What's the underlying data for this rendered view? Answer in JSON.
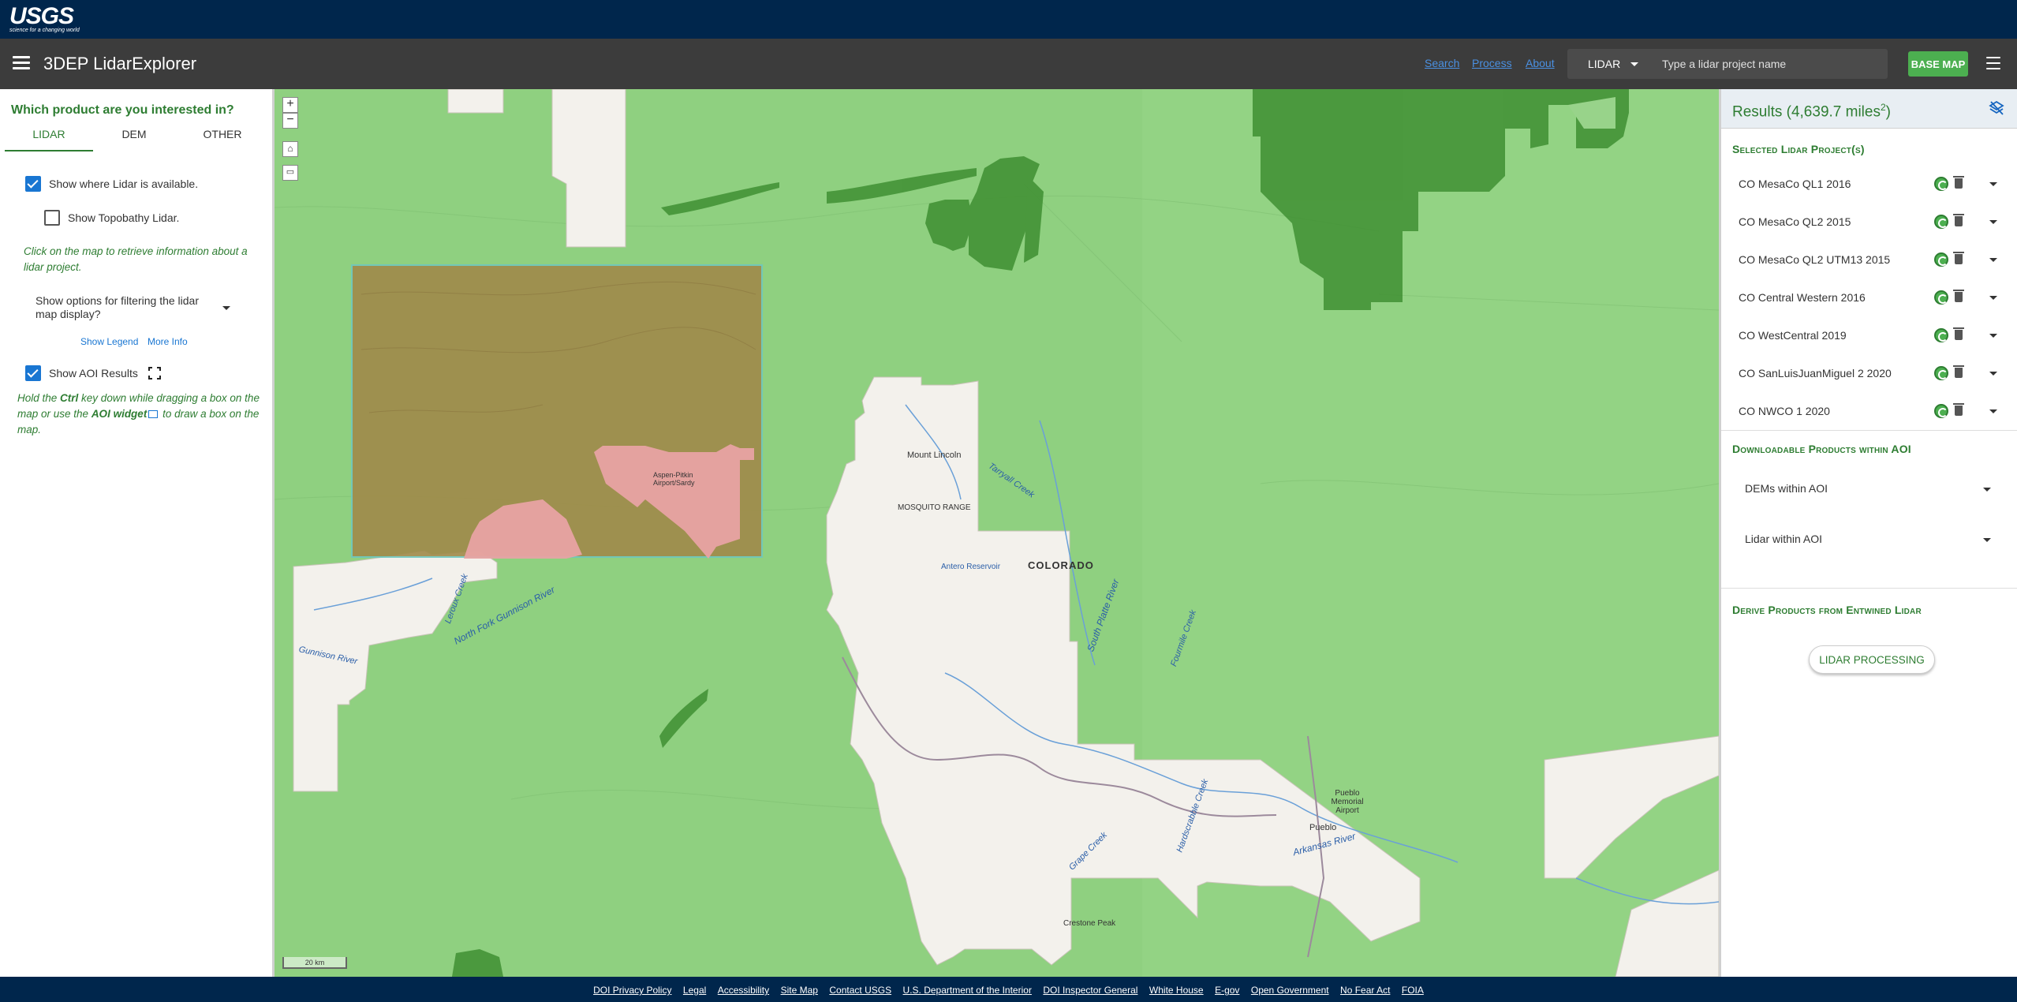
{
  "banner": {
    "logo_text": "USGS",
    "logo_tagline": "science for a changing world"
  },
  "header": {
    "app_title": "3DEP LidarExplorer",
    "links": [
      "Search",
      "Process",
      "About"
    ],
    "data_type": "LIDAR",
    "search_placeholder": "Type a lidar project name",
    "basemap_label": "BASE MAP",
    "menu_icon": "hamburger-icon"
  },
  "left_panel": {
    "question": "Which product are you interested in?",
    "tabs": [
      {
        "label": "LIDAR",
        "active": true
      },
      {
        "label": "DEM",
        "active": false
      },
      {
        "label": "OTHER",
        "active": false
      }
    ],
    "show_lidar_label": "Show where Lidar is available.",
    "show_lidar_checked": true,
    "show_topobathy_label": "Show Topobathy Lidar.",
    "show_topobathy_checked": false,
    "click_note": "Click on the map to retrieve information about a lidar project.",
    "filter_options_label": "Show options for filtering the lidar map display?",
    "show_legend_label": "Show Legend",
    "more_info_label": "More Info",
    "show_aoi_label": "Show AOI Results",
    "show_aoi_checked": true,
    "aoi_note_part1": "Hold the ",
    "aoi_note_ctrl": "Ctrl",
    "aoi_note_part2": " key down while dragging a box on the map or use the ",
    "aoi_note_widget": "AOI widget",
    "aoi_note_part3": " to draw a box on the map."
  },
  "map": {
    "zoom_in": "+",
    "zoom_out": "−",
    "scale_label": "20 km",
    "labels": [
      "COLORADO",
      "Arkansas River",
      "South Platte River",
      "Fourmile Creek",
      "Grape Creek",
      "Hardscrabble Creek",
      "North Fork Gunnison River",
      "Gunnison River",
      "Mount Lincoln",
      "Antero Reservoir",
      "MOSQUITO RANGE",
      "Tarryall Creek",
      "Pueblo",
      "Pueblo Memorial Airport",
      "Aspen-Pitkin Airport/Sardy",
      "Crestone Peak",
      "Leroux Creek"
    ]
  },
  "right_panel": {
    "results_prefix": "Results (4,639.7 miles",
    "results_sup": "2",
    "results_suffix": ")",
    "selected_title": "Selected Lidar Project(s)",
    "projects": [
      "CO MesaCo QL1 2016",
      "CO MesaCo QL2 2015",
      "CO MesaCo QL2 UTM13 2015",
      "CO Central Western 2016",
      "CO WestCentral 2019",
      "CO SanLuisJuanMiguel 2 2020",
      "CO NWCO 1 2020"
    ],
    "downloadable_title": "Downloadable Products within AOI",
    "downloads": [
      "DEMs within AOI",
      "Lidar within AOI"
    ],
    "derive_title": "Derive Products from Entwined Lidar",
    "processing_label": "LIDAR PROCESSING"
  },
  "footer": {
    "links": [
      "DOI Privacy Policy",
      "Legal",
      "Accessibility",
      "Site Map",
      "Contact USGS",
      "U.S. Department of the Interior",
      "DOI Inspector General",
      "White House",
      "E-gov",
      "Open Government",
      "No Fear Act",
      "FOIA"
    ]
  },
  "colors": {
    "header_bg": "#3c3c3c",
    "banner_bg": "#00264c",
    "accent_green": "#2e7d32",
    "button_green": "#4caf50",
    "map_lidar_green": "#8fd080",
    "map_dark_green": "#3f8f32",
    "aoi_fill": "#a08a4a"
  }
}
